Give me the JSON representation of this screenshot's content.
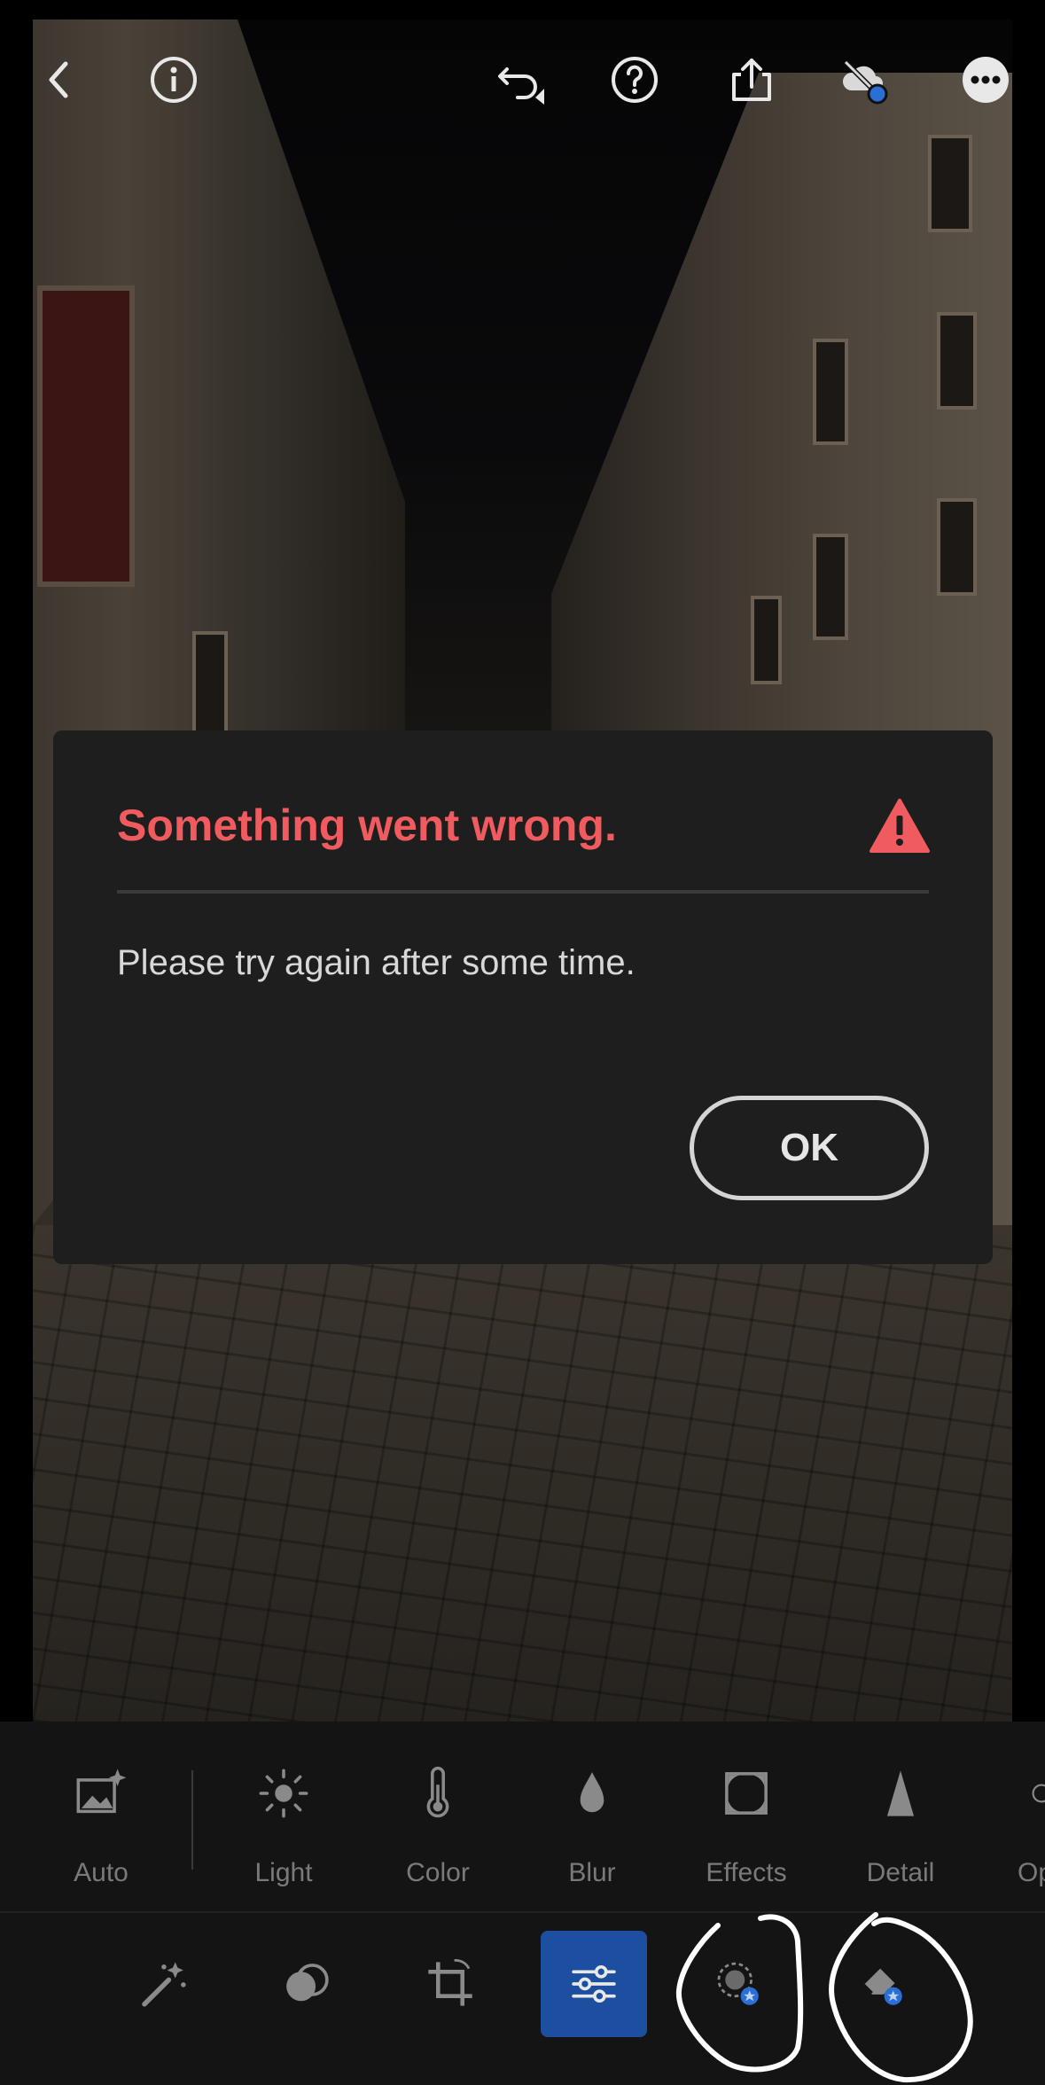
{
  "dialog": {
    "title": "Something went wrong.",
    "message": "Please try again after some time.",
    "ok_label": "OK",
    "title_color": "#ef5b5f"
  },
  "top_bar": {
    "icons": [
      "back-arrow-icon",
      "info-icon",
      "undo-icon",
      "help-icon",
      "share-icon",
      "cloud-sync-icon",
      "more-icon"
    ]
  },
  "tool_strip": {
    "items": [
      {
        "label": "Auto",
        "icon": "auto-image-icon"
      },
      {
        "label": "Light",
        "icon": "sun-icon"
      },
      {
        "label": "Color",
        "icon": "thermometer-icon"
      },
      {
        "label": "Blur",
        "icon": "drop-icon"
      },
      {
        "label": "Effects",
        "icon": "vignette-icon"
      },
      {
        "label": "Detail",
        "icon": "triangle-icon"
      },
      {
        "label": "Op",
        "icon": "optics-icon"
      }
    ]
  },
  "mode_bar": {
    "items": [
      "presets-wand-icon",
      "masking-icon",
      "crop-icon",
      "edit-sliders-icon",
      "healing-premium-icon",
      "remove-premium-icon"
    ],
    "active": "edit-sliders-icon",
    "accent_color": "#1c4fa0"
  }
}
